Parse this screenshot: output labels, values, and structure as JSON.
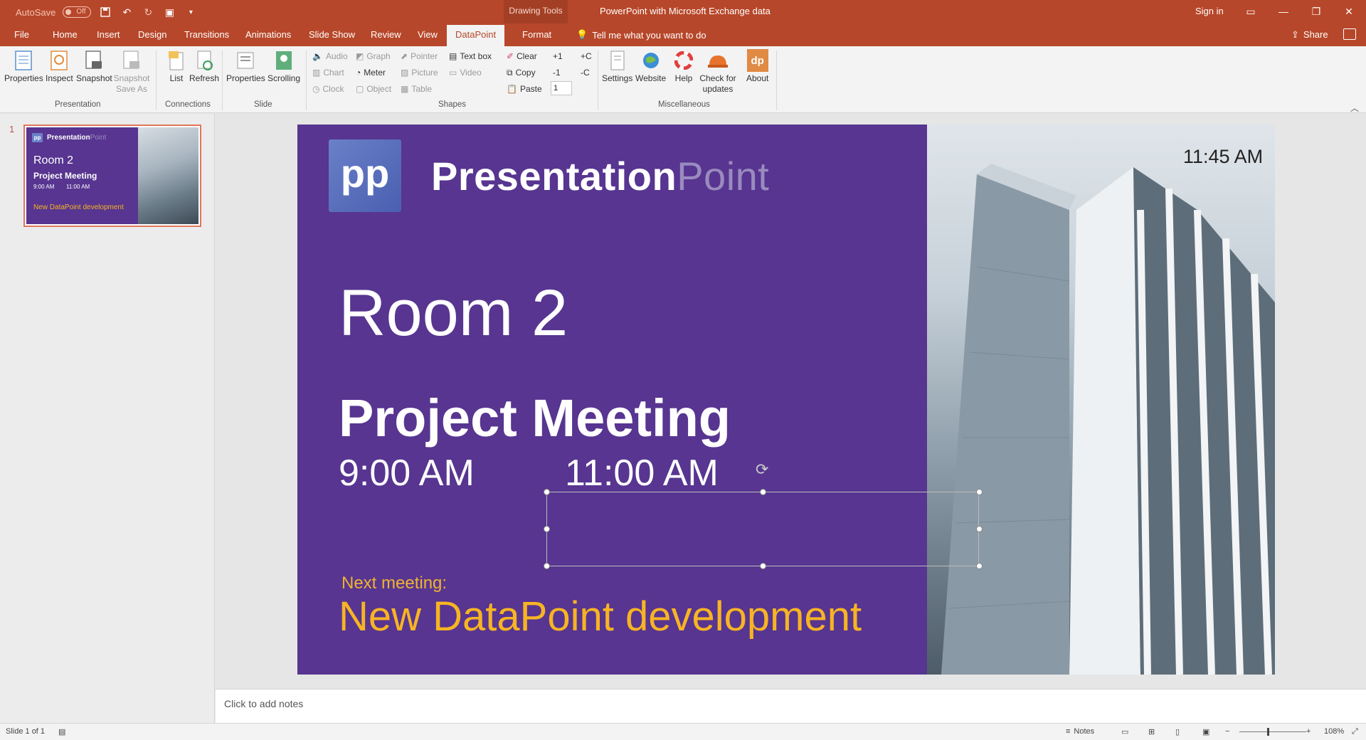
{
  "titlebar": {
    "autosave_label": "AutoSave",
    "autosave_state": "Off",
    "context_tools": "Drawing Tools",
    "doc_title": "PowerPoint with Microsoft Exchange data",
    "signin": "Sign in"
  },
  "tabs": [
    "File",
    "Home",
    "Insert",
    "Design",
    "Transitions",
    "Animations",
    "Slide Show",
    "Review",
    "View",
    "DataPoint",
    "Format"
  ],
  "active_tab": "DataPoint",
  "tellme": "Tell me what you want to do",
  "share": "Share",
  "ribbon": {
    "presentation": {
      "label": "Presentation",
      "buttons": [
        "Properties",
        "Inspect",
        "Snapshot",
        "Snapshot Save As"
      ]
    },
    "connections": {
      "label": "Connections",
      "buttons": [
        "List",
        "Refresh"
      ]
    },
    "slide": {
      "label": "Slide",
      "buttons": [
        "Properties",
        "Scrolling"
      ]
    },
    "shapes": {
      "label": "Shapes",
      "col1": [
        "Audio",
        "Chart",
        "Clock"
      ],
      "col2": [
        "Graph",
        "Meter",
        "Object"
      ],
      "col3": [
        "Pointer",
        "Picture",
        "Table"
      ],
      "col4": [
        "Text box",
        "Video"
      ],
      "col5": [
        "Clear",
        "Copy",
        "Paste"
      ],
      "col6": [
        "+1",
        "-1"
      ],
      "col7": [
        "+C",
        "-C"
      ],
      "counter_value": "1"
    },
    "misc": {
      "label": "Miscellaneous",
      "buttons": [
        "Settings",
        "Website",
        "Help",
        "Check for updates",
        "About"
      ]
    }
  },
  "thumbnail": {
    "number": "1",
    "brand_a": "Presentation",
    "brand_b": "Point",
    "room": "Room 2",
    "meeting": "Project Meeting",
    "start": "9:00 AM",
    "end": "11:00 AM",
    "next": "New DataPoint development"
  },
  "slide": {
    "logo": "pp",
    "brand_a": "Presentation",
    "brand_b": "Point",
    "clock": "11:45 AM",
    "room": "Room 2",
    "meeting": "Project Meeting",
    "start": "9:00 AM",
    "end": "11:00 AM",
    "next_label": "Next meeting:",
    "next_title": "New DataPoint development"
  },
  "notes_placeholder": "Click to add notes",
  "status": {
    "slide_info": "Slide 1 of 1",
    "notes": "Notes",
    "zoom": "108%"
  },
  "colors": {
    "accent": "#b7472a",
    "slide_bg": "#573590",
    "highlight": "#f7b423"
  }
}
